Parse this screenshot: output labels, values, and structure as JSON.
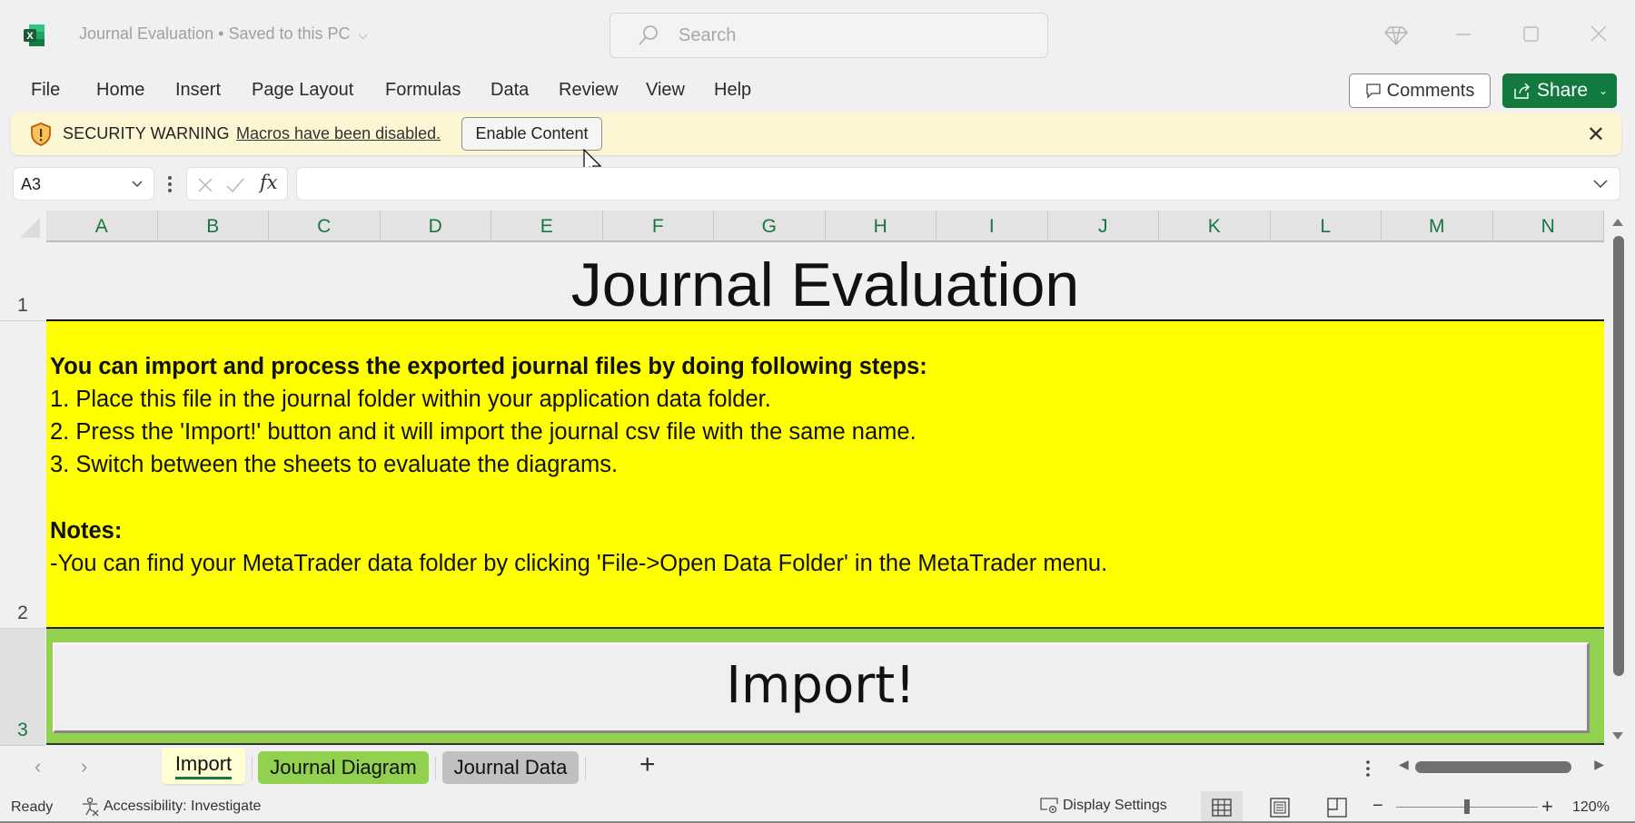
{
  "app": {
    "doc_title": "Journal Evaluation",
    "save_status": "Saved to this PC",
    "search_placeholder": "Search"
  },
  "ribbon": {
    "tabs": [
      "File",
      "Home",
      "Insert",
      "Page Layout",
      "Formulas",
      "Data",
      "Review",
      "View",
      "Help"
    ],
    "comments_label": "Comments",
    "share_label": "Share"
  },
  "security_bar": {
    "title": "SECURITY WARNING",
    "message": "Macros have been disabled.",
    "button_label": "Enable Content"
  },
  "formula_bar": {
    "name_box": "A3",
    "formula": ""
  },
  "grid": {
    "columns": [
      "A",
      "B",
      "C",
      "D",
      "E",
      "F",
      "G",
      "H",
      "I",
      "J",
      "K",
      "L",
      "M",
      "N"
    ],
    "rows": [
      "1",
      "2",
      "3"
    ],
    "selected_row": "3",
    "title_cell": "Journal Evaluation",
    "instructions": {
      "heading": "You can import and process the exported journal files by doing following steps:",
      "steps": [
        "1. Place this file in the journal folder within your application data folder.",
        "2. Press the 'Import!' button and it will import the journal csv file with the same name.",
        "3. Switch between the sheets to evaluate the diagrams."
      ],
      "notes_heading": "Notes:",
      "notes": [
        "-You can find your MetaTrader data folder by clicking 'File->Open Data Folder' in the MetaTrader menu."
      ]
    },
    "import_button_label": "Import!",
    "colors": {
      "instructions_fill": "#ffff00",
      "button_row_fill": "#92d050"
    }
  },
  "sheets": {
    "tabs": [
      {
        "label": "Import",
        "active": true,
        "color": "#fefed2"
      },
      {
        "label": "Journal Diagram",
        "active": false,
        "color": "#92d050"
      },
      {
        "label": "Journal Data",
        "active": false,
        "color": "#c0c0c0"
      }
    ]
  },
  "status_bar": {
    "ready": "Ready",
    "accessibility": "Accessibility: Investigate",
    "display_settings": "Display Settings",
    "zoom": "120%",
    "zoom_level_percent": 120
  }
}
